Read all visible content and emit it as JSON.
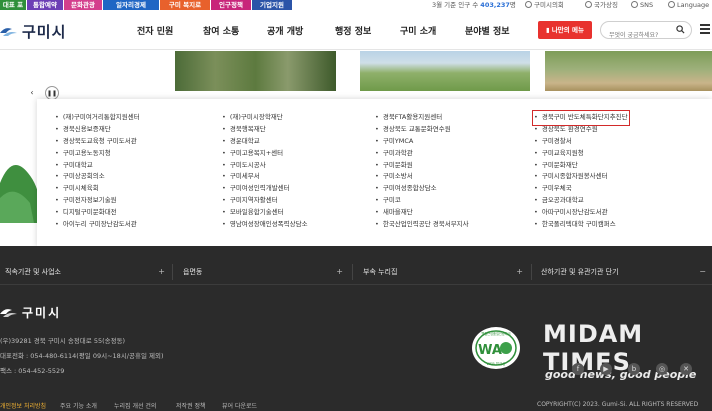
{
  "topbar": {
    "quick_links": [
      {
        "label": "대표 포털",
        "bg": "#2f8f3a"
      },
      {
        "label": "통합예약",
        "bg": "#6c3fb5"
      },
      {
        "label": "문화관광",
        "bg": "#d43f8d"
      },
      {
        "label": "일자리경제",
        "bg": "#1f66c4"
      },
      {
        "label": "구미 복지로",
        "bg": "#e8612c"
      },
      {
        "label": "인구정책",
        "bg": "#c8257a"
      },
      {
        "label": "기업지원",
        "bg": "#2b54a8"
      }
    ],
    "population_prefix": "3월 기준 인구 수",
    "population_value": "403,237",
    "population_unit": "명",
    "utility_links": [
      "구미시의회",
      "국가상징",
      "SNS",
      "Language"
    ]
  },
  "header": {
    "logo_text": "구미시",
    "nav": [
      "전자 민원",
      "참여 소통",
      "공개 개방",
      "행정 정보",
      "구미 소개",
      "분야별 정보"
    ],
    "my_menu_label": "나만의 메뉴",
    "search_placeholder": "무엇이 궁금하세요?"
  },
  "banner": {
    "prev_label": "‹",
    "pause_label": "❚❚"
  },
  "related_sites": {
    "columns": [
      [
        "(재)구미여거리통합지원센터",
        "경북신용보증재단",
        "경상북도교육청 구미도서관",
        "구미고용노동지청",
        "구미대학교",
        "구미상공회의소",
        "구미시체육회",
        "구미전자정보기술원",
        "디지털구미문화대전",
        "아이누리 구미장난감도서관"
      ],
      [
        "(재)구미시장학재단",
        "경북행복재단",
        "경운대학교",
        "구미고용복지+센터",
        "구미도시공사",
        "구미세무서",
        "구미여성인력개발센터",
        "구미지역자활센터",
        "모바일융합기술센터",
        "영남여성장애인성폭력상담소"
      ],
      [
        "경북FTA활용지원센터",
        "경상북도 교통문화연수원",
        "구미YMCA",
        "구미과학관",
        "구미문화원",
        "구미소방서",
        "구미여성종합상담소",
        "구미코",
        "새마을재단",
        "한국산업인력공단 경북서부지사"
      ],
      [
        "경북구미 반도체특화단지추진단",
        "경상북도 환경연수원",
        "구미경찰서",
        "구미교육지원청",
        "구미문화재단",
        "구미시종합자원봉사센터",
        "구미우체국",
        "금오공과대학교",
        "아따구미시장난감도서관",
        "한국폴리텍대학 구미캠퍼스"
      ]
    ]
  },
  "footer": {
    "tabs": [
      "직속기관 및 사업소",
      "읍면동",
      "부속 누리집",
      "산하기관 및 유관기관 단기"
    ],
    "logo_text": "구미시",
    "address": "(우)39281 경북 구미시 송정대로 55(송정동)",
    "phone": "대표전화 : 054-480-6114(평일 09시~18시/공휴일 제외)",
    "fax": "팩스 : 054-452-5529",
    "emblem_top": "웹접근성품질인증마크",
    "emblem_mid": "WA",
    "emblem_bottom": "WEB 접근성",
    "watermark_title": "MIDAM TIMES",
    "watermark_slogan": "good news, good people",
    "bottom_links": [
      "개인정보 처리방침",
      "주요 기능 소개",
      "누리집 개선 건의",
      "저작권 정책",
      "뷰어 다운로드"
    ],
    "copyright": "COPYRIGHT(C) 2023. Gumi-Si. ALL RIGHTS RESERVED"
  }
}
